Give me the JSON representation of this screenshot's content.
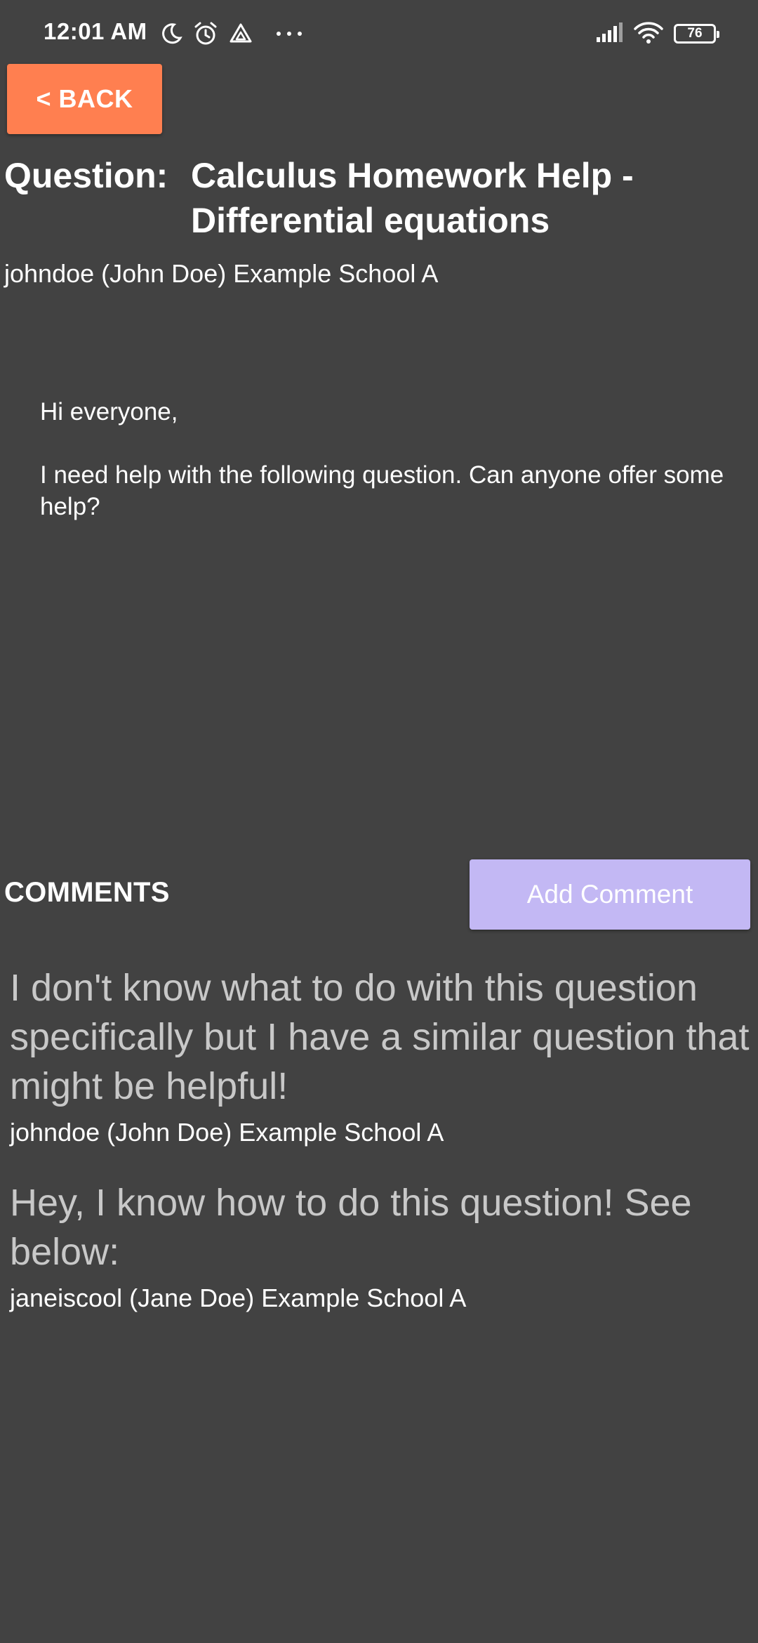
{
  "status_bar": {
    "time": "12:01 AM",
    "left_icons": [
      "moon-icon",
      "alarm-icon",
      "drive-icon",
      "more-dots-icon"
    ],
    "right_icons": [
      "signal-icon",
      "wifi-icon",
      "battery-icon"
    ],
    "battery_level": "76"
  },
  "header": {
    "back_label": "< BACK",
    "back_color": "#ff7f50"
  },
  "question": {
    "label": "Question:",
    "title": "Calculus Homework Help - Differential equations",
    "author": "johndoe (John Doe) Example School A",
    "body": [
      "Hi everyone,",
      "I need help with the following question. Can anyone offer some help?"
    ]
  },
  "comments_section": {
    "heading": "COMMENTS",
    "add_label": "Add Comment",
    "add_color": "#c3b8f4",
    "items": [
      {
        "text": "I don't know what to do with this question specifically but I have a similar question that might be helpful!",
        "author": "johndoe (John Doe) Example School A"
      },
      {
        "text": "Hey, I know how to do this question! See below:",
        "author": "janeiscool (Jane Doe) Example School A"
      }
    ]
  },
  "colors": {
    "background": "#424242",
    "text": "#ffffff",
    "comment_text": "#c8c8c8"
  }
}
